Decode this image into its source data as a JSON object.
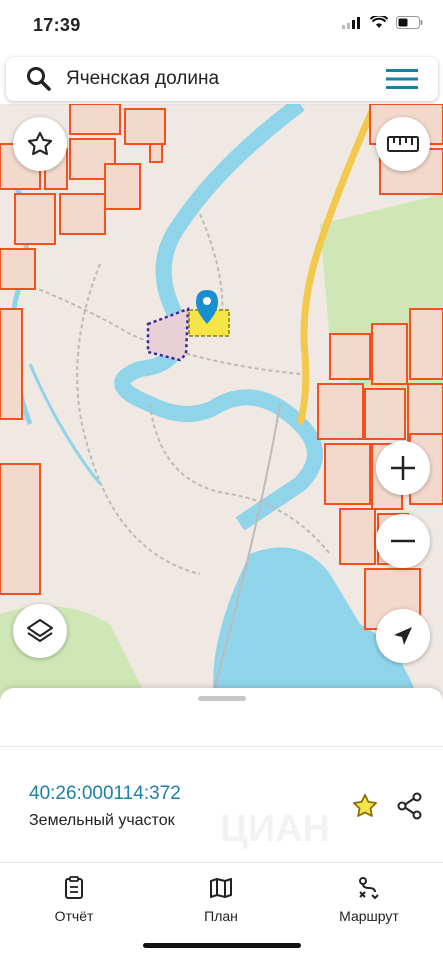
{
  "status_bar": {
    "time": "17:39"
  },
  "search": {
    "query": "Яченская долина",
    "icon": "search-icon",
    "menu_icon": "hamburger-menu-icon"
  },
  "map": {
    "controls": {
      "favorite_icon": "star-outline-icon",
      "ruler_icon": "ruler-icon",
      "zoom_in_icon": "plus-icon",
      "zoom_out_icon": "minus-icon",
      "layers_icon": "layers-icon",
      "location_icon": "navigation-arrow-icon"
    },
    "colors": {
      "water": "#8fd4e8",
      "forest": "#cfe7b6",
      "parcel": "#f4511e",
      "road": "#f2c94c",
      "selected": "#f7e547",
      "marker": "#1a8fd0",
      "boundary": "#3b2a9c"
    }
  },
  "sheet": {
    "cadastral_number": "40:26:000114:372",
    "parcel_type": "Земельный участок",
    "tabs": [
      {
        "label": "Отчёт",
        "icon": "report-icon"
      },
      {
        "label": "План",
        "icon": "map-icon"
      },
      {
        "label": "Маршрут",
        "icon": "route-icon"
      }
    ],
    "colors": {
      "accent": "#1c7fa8",
      "star": "#f2c400"
    }
  }
}
